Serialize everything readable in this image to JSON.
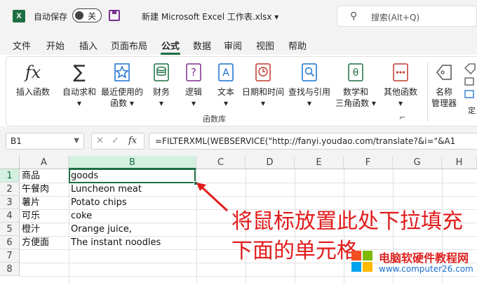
{
  "app": {
    "logo_letter": "X",
    "autosave_label": "自动保存",
    "autosave_state": "关",
    "title": "新建 Microsoft Excel 工作表.xlsx",
    "title_caret": "▾",
    "search_placeholder": "搜索(Alt+Q)",
    "search_icon": "⚲"
  },
  "menu": {
    "tabs": [
      "文件",
      "开始",
      "插入",
      "页面布局",
      "公式",
      "数据",
      "审阅",
      "视图",
      "帮助"
    ],
    "active_index": 4
  },
  "ribbon": {
    "buttons": [
      {
        "icon": "fx-icon",
        "line1": "插入函数",
        "line2": ""
      },
      {
        "icon": "sum-icon",
        "line1": "自动求和",
        "line2": "▾"
      },
      {
        "icon": "star-icon",
        "line1": "最近使用的",
        "line2": "函数 ▾"
      },
      {
        "icon": "database-icon",
        "line1": "财务",
        "line2": "▾"
      },
      {
        "icon": "question-book-icon",
        "line1": "逻辑",
        "line2": "▾"
      },
      {
        "icon": "text-book-icon",
        "line1": "文本",
        "line2": "▾"
      },
      {
        "icon": "clock-book-icon",
        "line1": "日期和时间",
        "line2": "▾"
      },
      {
        "icon": "search-book-icon",
        "line1": "查找与引用",
        "line2": "▾"
      },
      {
        "icon": "theta-book-icon",
        "line1": "数学和",
        "line2": "三角函数 ▾"
      },
      {
        "icon": "more-book-icon",
        "line1": "其他函数",
        "line2": "▾"
      },
      {
        "icon": "name-tag-icon",
        "line1": "名称",
        "line2": "管理器"
      }
    ],
    "group_label": "函数库",
    "partial_label": "定"
  },
  "formula_bar": {
    "name_box": "B1",
    "cancel_glyph": "✕",
    "enter_glyph": "✓",
    "fx_glyph": "fx",
    "formula": "=FILTERXML(WEBSERVICE(\"http://fanyi.youdao.com/translate?&i=\"&A1"
  },
  "grid": {
    "columns": [
      "A",
      "B",
      "C",
      "D",
      "E",
      "F",
      "G",
      "H"
    ],
    "selected_column": "B",
    "rows": [
      "1",
      "2",
      "3",
      "4",
      "5",
      "6",
      "7",
      "8"
    ],
    "selected_row": "1",
    "cells": [
      {
        "a": "商品",
        "b": "goods"
      },
      {
        "a": "午餐肉",
        "b": "Luncheon meat"
      },
      {
        "a": " 薯片",
        "b": "Potato chips"
      },
      {
        "a": "可乐",
        "b": "coke"
      },
      {
        "a": "橙汁",
        "b": "Orange juice,"
      },
      {
        "a": "方便面",
        "b": "The instant noodles"
      },
      {
        "a": "",
        "b": ""
      },
      {
        "a": "",
        "b": ""
      }
    ]
  },
  "annotation": {
    "text": "将鼠标放置此处下拉填充下面的单元格",
    "color": "#e11b1b"
  },
  "watermark": {
    "title": "电脑软硬件教程网",
    "url": "www.computer26.com"
  },
  "colors": {
    "accent": "#1d6f42",
    "annotation": "#e11b1b"
  }
}
